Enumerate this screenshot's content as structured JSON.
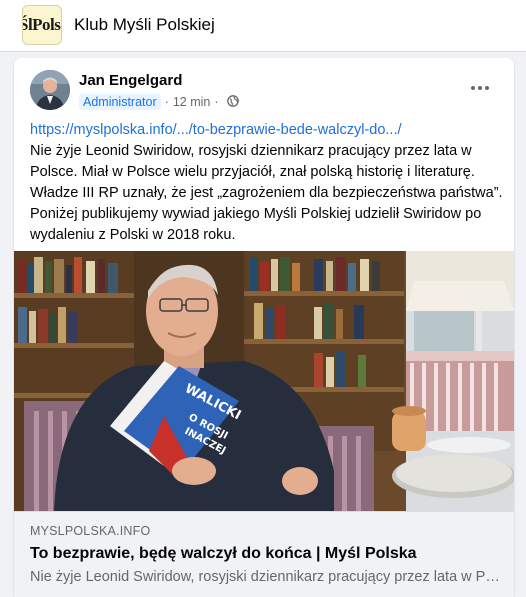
{
  "group": {
    "logo_text": "ŚlPols",
    "name": "Klub Myśli Polskiej"
  },
  "post": {
    "author": "Jan Engelgard",
    "badge": "Administrator",
    "separator": "·",
    "time": "12 min",
    "visibility_icon": "globe-icon",
    "more_icon": "more-options-icon",
    "link": "https://myslpolska.info/.../to-bezprawie-bede-walczyl-do.../",
    "body": "Nie żyje Leonid Swiridow, rosyjski dziennikarz pracujący przez lata w Polsce. Miał w Polsce wielu przyjaciół, znał polską historię i literaturę. Władze III RP uznały, że jest „zagrożeniem dla bezpieczeństwa państwa”. Poniżej publikujemy wywiad jakiego Myśli Polskiej udzielił Swiridow po wydaleniu z Polski w 2018 roku."
  },
  "photo": {
    "book_author": "WALICKI",
    "book_title_line1": "O ROSJI",
    "book_title_line2": "INACZEJ"
  },
  "link_preview": {
    "domain": "MYSLPOLSKA.INFO",
    "title": "To bezprawie, będę walczył do końca | Myśl Polska",
    "description": "Nie żyje Leonid Swiridow, rosyjski dziennikarz pracujący przez lata w Polsce..."
  },
  "colors": {
    "link": "#216fdb",
    "badge_bg": "#e7f3ff",
    "badge_text": "#1b74e4",
    "page_bg": "#f0f2f5"
  }
}
